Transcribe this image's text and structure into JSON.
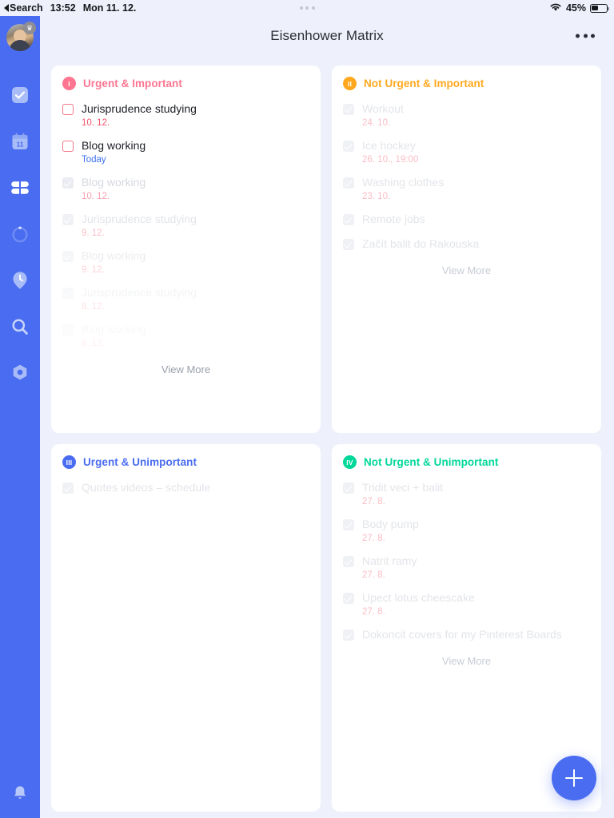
{
  "statusbar": {
    "back_label": "Search",
    "time": "13:52",
    "date": "Mon 11. 12.",
    "battery_percent": "45%",
    "wifi_icon": "wifi-icon",
    "battery_icon": "battery-icon"
  },
  "header": {
    "title": "Eisenhower Matrix",
    "more_icon": "more-horizontal-icon"
  },
  "sidebar": {
    "avatar": "user-avatar",
    "crown_badge": "crown-icon",
    "items": [
      {
        "icon": "tasks-checkbox-icon",
        "active": false
      },
      {
        "icon": "calendar-icon",
        "active": false,
        "day": "11"
      },
      {
        "icon": "matrix-grid-icon",
        "active": true
      },
      {
        "icon": "progress-circle-icon",
        "active": false
      },
      {
        "icon": "clock-pin-icon",
        "active": false
      },
      {
        "icon": "search-icon",
        "active": false
      },
      {
        "icon": "settings-hexagon-icon",
        "active": false
      }
    ],
    "bottom_item": {
      "icon": "bell-icon"
    }
  },
  "fab": {
    "icon": "plus-icon",
    "label": "Add task"
  },
  "colors": {
    "accent": "#4a6cf0",
    "quadrant1": "#fd7590",
    "quadrant2": "#ffa81f",
    "quadrant3": "#4a6cf0",
    "quadrant4": "#00d79a",
    "overdue_date": "#f4526a",
    "today_date": "#3c6ef0",
    "background": "#eef1fb",
    "card": "#ffffff"
  },
  "quadrants": [
    {
      "numeral": "I",
      "title": "Urgent & Important",
      "color": "#fd7590",
      "view_more": "View More",
      "view_more_dim": false,
      "tasks": [
        {
          "title": "Jurisprudence studying",
          "date": "10. 12.",
          "date_style": "red",
          "done": false,
          "fade": 0
        },
        {
          "title": "Blog working",
          "date": "Today",
          "date_style": "blue",
          "done": false,
          "fade": 0
        },
        {
          "title": "Blog working",
          "date": "10. 12.",
          "date_style": "red",
          "done": true,
          "fade": 1
        },
        {
          "title": "Jurisprudence studying",
          "date": "9. 12.",
          "date_style": "red",
          "done": true,
          "fade": 2
        },
        {
          "title": "Blog working",
          "date": "9. 12.",
          "date_style": "red",
          "done": true,
          "fade": 3
        },
        {
          "title": "Jurisprudence studying",
          "date": "8. 12.",
          "date_style": "red",
          "done": true,
          "fade": 4
        },
        {
          "title": "Blog working",
          "date": "8. 12.",
          "date_style": "red",
          "done": true,
          "fade": 5
        }
      ]
    },
    {
      "numeral": "II",
      "title": "Not Urgent & Important",
      "color": "#ffa81f",
      "view_more": "View More",
      "view_more_dim": true,
      "tasks": [
        {
          "title": "Workout",
          "date": "24. 10.",
          "date_style": "red",
          "done": true,
          "fade": 2
        },
        {
          "title": "Ice hockey",
          "date": "26. 10., 19:00",
          "date_style": "red",
          "done": true,
          "fade": 2
        },
        {
          "title": "Washing clothes",
          "date": "23. 10.",
          "date_style": "red",
          "done": true,
          "fade": 2
        },
        {
          "title": "Remote jobs",
          "date": "",
          "date_style": "",
          "done": true,
          "fade": 2
        },
        {
          "title": "Začít balit do Rakouska",
          "date": "",
          "date_style": "",
          "done": true,
          "fade": 2
        }
      ]
    },
    {
      "numeral": "III",
      "title": "Urgent & Unimportant",
      "color": "#4a6cf0",
      "view_more": "",
      "view_more_dim": true,
      "tasks": [
        {
          "title": "Quotes videos – schedule",
          "date": "",
          "date_style": "",
          "done": true,
          "fade": 2
        }
      ]
    },
    {
      "numeral": "IV",
      "title": "Not Urgent & Unimportant",
      "color": "#00d79a",
      "view_more": "View More",
      "view_more_dim": true,
      "tasks": [
        {
          "title": "Tridit veci + balit",
          "date": "27. 8.",
          "date_style": "red",
          "done": true,
          "fade": 2
        },
        {
          "title": "Body pump",
          "date": "27. 8.",
          "date_style": "red",
          "done": true,
          "fade": 2
        },
        {
          "title": "Natrit ramy",
          "date": "27. 8.",
          "date_style": "red",
          "done": true,
          "fade": 2
        },
        {
          "title": "Upect lotus cheescake",
          "date": "27. 8.",
          "date_style": "red",
          "done": true,
          "fade": 2
        },
        {
          "title": "Dokoncit covers for my Pinterest Boards",
          "date": "",
          "date_style": "",
          "done": true,
          "fade": 2
        }
      ]
    }
  ]
}
